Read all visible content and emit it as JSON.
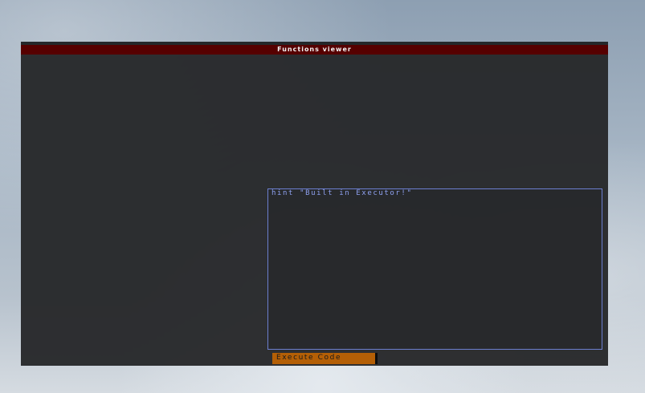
{
  "window": {
    "title": "Functions viewer"
  },
  "editor": {
    "code": "hint \"Built in Executor!\""
  },
  "actions": {
    "execute_label": "Execute Code"
  },
  "colors": {
    "titlebar": "#560000",
    "panel": "#26282a",
    "editor_border": "#6c7fd0",
    "code_text": "#8ea0f0",
    "execute_button": "#b45f06"
  }
}
